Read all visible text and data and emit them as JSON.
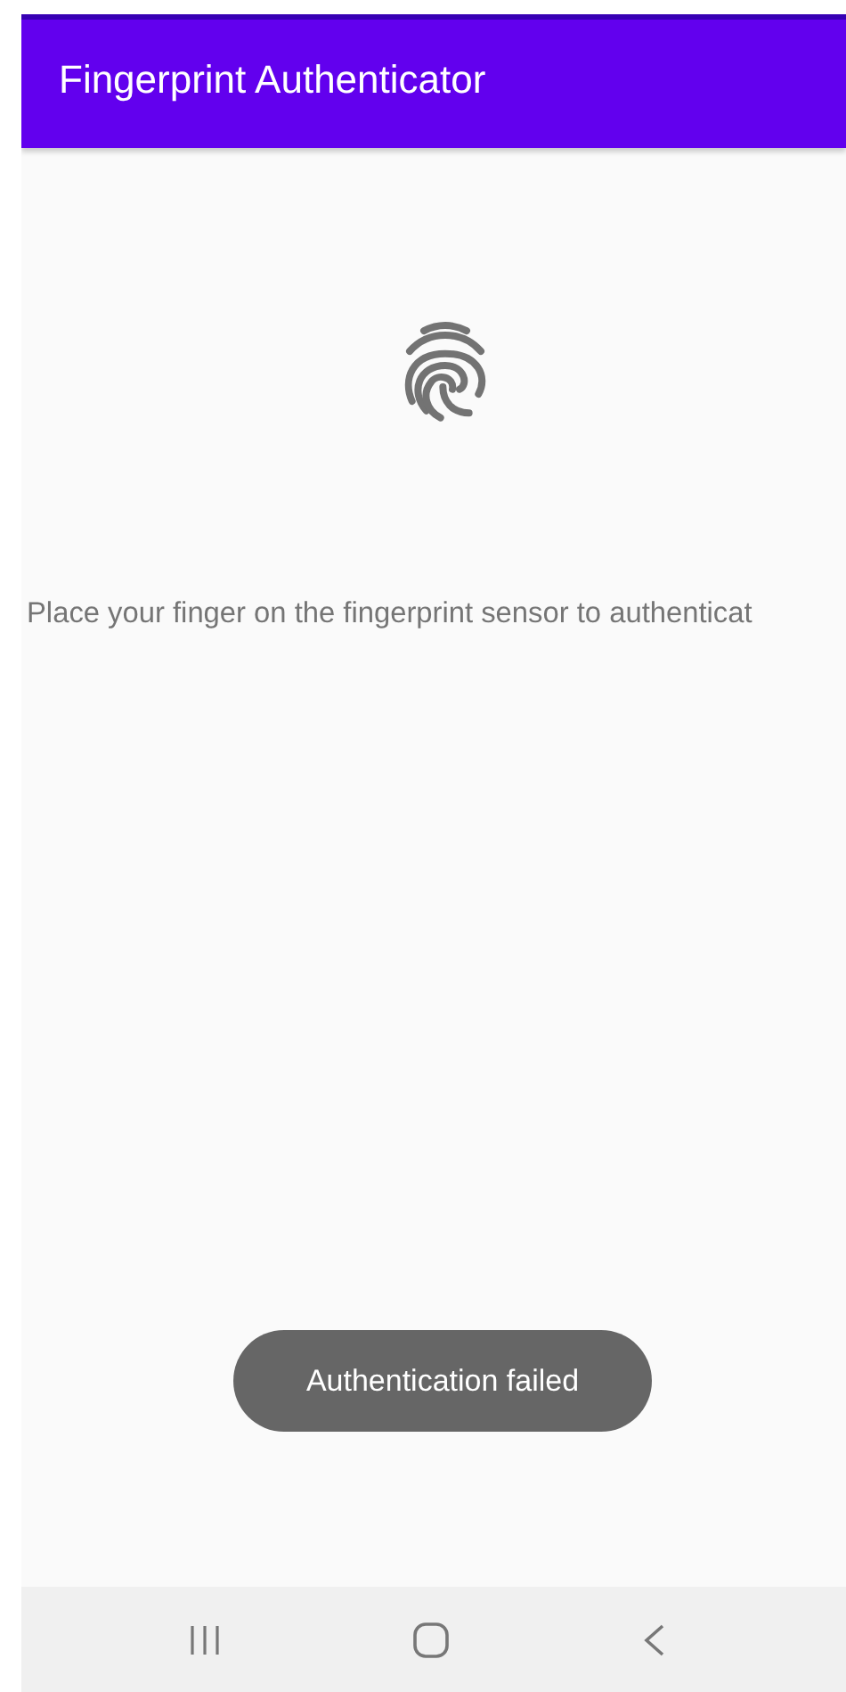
{
  "app_bar": {
    "title": "Fingerprint Authenticator"
  },
  "prompt": "Place your finger on the fingerprint sensor to authenticat",
  "toast": "Authentication failed"
}
